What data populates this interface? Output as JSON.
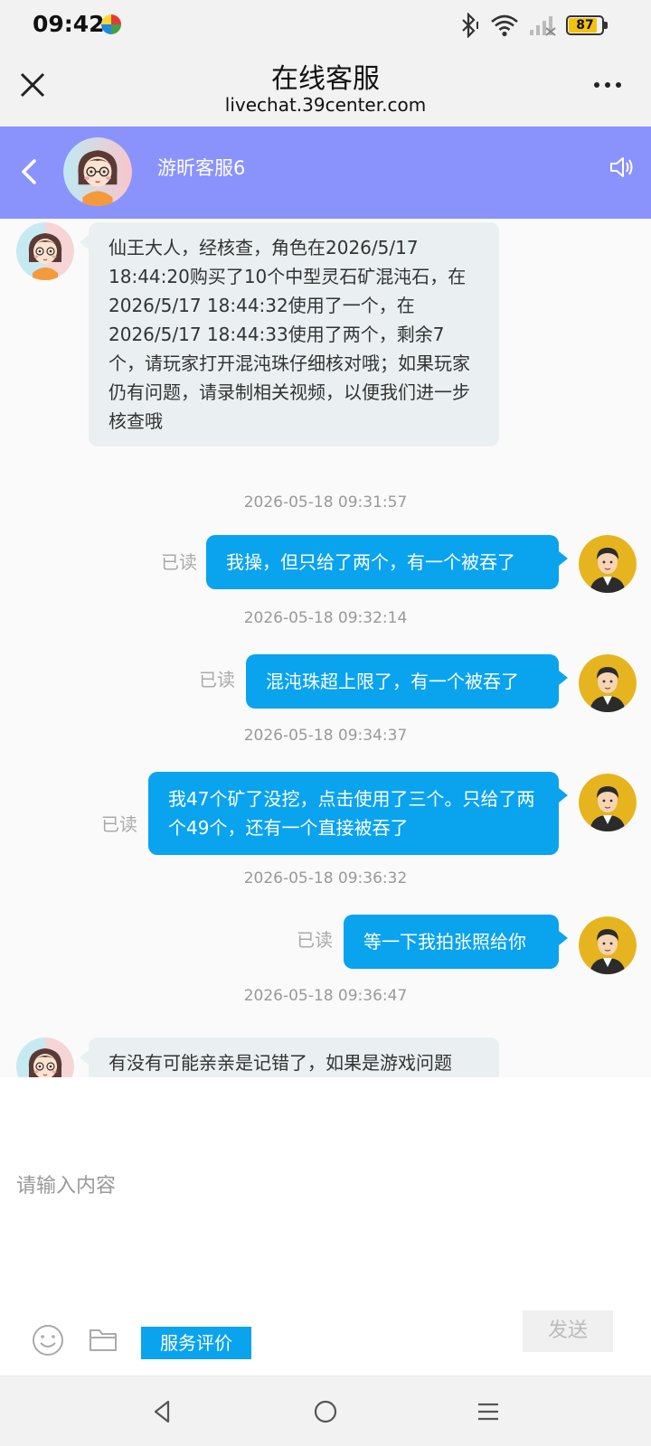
{
  "status_bar": {
    "time": "09:42",
    "battery": "87",
    "battery_level": 0.87,
    "icons": [
      "bluetooth-icon",
      "wifi-icon",
      "signal-icon",
      "battery-icon"
    ]
  },
  "title_bar": {
    "title": "在线客服",
    "url": "livechat.39center.com"
  },
  "chat_header": {
    "agent_name": "游昕客服6"
  },
  "messages": {
    "m1": "仙王大人，经核查，角色在2026/5/17 18:44:20购买了10个中型灵石矿混沌石，在2026/5/17 18:44:32使用了一个，在2026/5/17 18:44:33使用了两个，剩余7个，请玩家打开混沌珠仔细核对哦；如果玩家仍有问题，请录制相关视频，以便我们进一步核查哦",
    "t2": "2026-05-18 09:31:57",
    "m2": "我操，但只给了两个，有一个被吞了",
    "r2": "已读",
    "t3": "2026-05-18 09:32:14",
    "m3": "混沌珠超上限了，有一个被吞了",
    "r3": "已读",
    "t4": "2026-05-18 09:34:37",
    "m4": "我47个矿了没挖，点击使用了三个。只给了两个49个，还有一个直接被吞了",
    "r4": "已读",
    "t5": "2026-05-18 09:36:32",
    "m5": "等一下我拍张照给你",
    "r5": "已读",
    "t6": "2026-05-18 09:36:47",
    "m6": "有没有可能亲亲是记错了，如果是游戏问题"
  },
  "input": {
    "placeholder": "请输入内容",
    "rate_label": "服务评价",
    "send_label": "发送"
  },
  "colors": {
    "header_bg": "#8a93fb",
    "outgoing_bubble": "#0aa3ee",
    "incoming_bubble": "#eaeff2"
  }
}
